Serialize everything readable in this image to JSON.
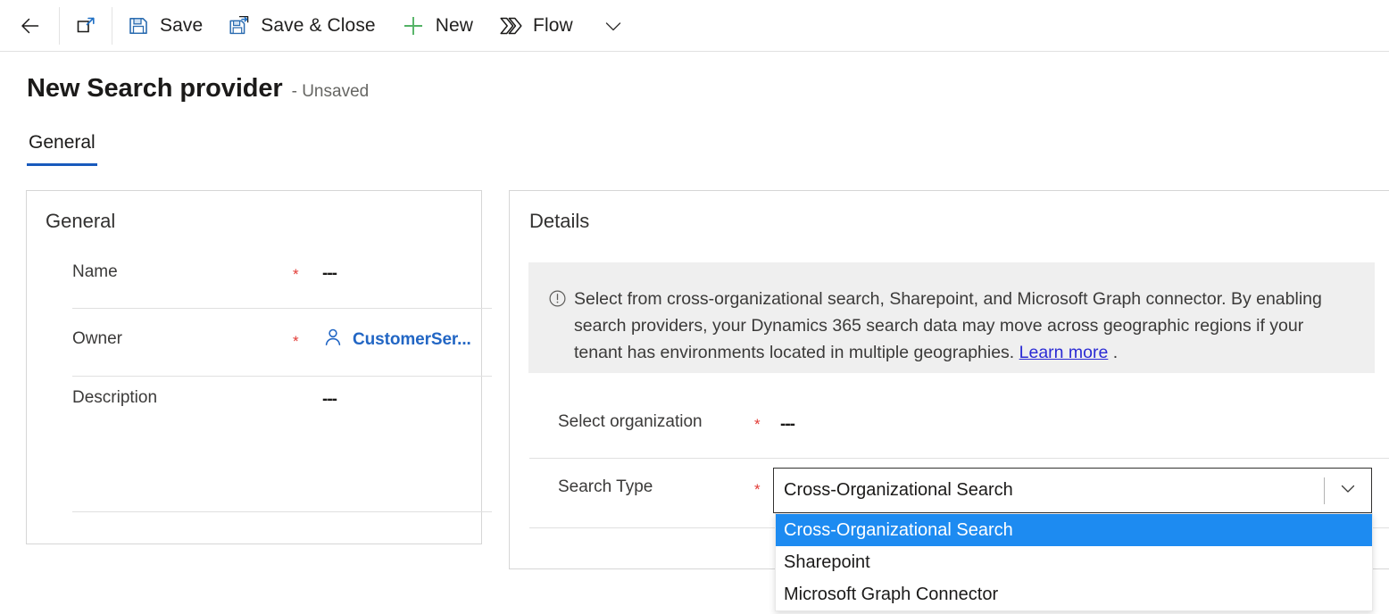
{
  "commandbar": {
    "items": [
      {
        "icon": "back-arrow-icon",
        "label": ""
      },
      {
        "icon": "popout-icon",
        "label": ""
      },
      {
        "icon": "save-icon",
        "label": "Save"
      },
      {
        "icon": "save-and-close-icon",
        "label": "Save & Close"
      },
      {
        "icon": "plus-icon",
        "label": "New"
      },
      {
        "icon": "flow-icon",
        "label": "Flow"
      },
      {
        "icon": "chevron-down-icon",
        "label": ""
      }
    ],
    "back_label": "Back",
    "popout_label": "Open in new window",
    "save_label": "Save",
    "save_close_label": "Save & Close",
    "new_label": "New",
    "flow_label": "Flow"
  },
  "header": {
    "title": "New Search provider",
    "status": "- Unsaved"
  },
  "tabs": [
    {
      "label": "General",
      "active": true
    }
  ],
  "general_card": {
    "title": "General",
    "rows": [
      {
        "label": "Name",
        "required": "*",
        "value": "---"
      },
      {
        "label": "Owner",
        "required": "*",
        "value": "CustomerSer...",
        "icon": "person-icon"
      },
      {
        "label": "Description",
        "required": "",
        "value": "---"
      }
    ]
  },
  "details_card": {
    "title": "Details",
    "infobar": {
      "icon": "info-circle-icon",
      "text_before": "Select from cross-organizational search, Sharepoint, and Microsoft Graph connector. By enabling search providers, your Dynamics 365 search data may move across geographic regions if your tenant has environments located in multiple geographies. ",
      "link": "Learn more",
      "text_after": " ."
    },
    "rows": [
      {
        "label": "Select organization",
        "required": "*",
        "value": "---"
      },
      {
        "label": "Search Type",
        "required": "*",
        "value": "Cross-Organizational Search"
      }
    ],
    "search_type_combo": {
      "value": "Cross-Organizational Search",
      "caret_icon": "chevron-down-icon",
      "options": [
        {
          "label": "Cross-Organizational Search",
          "selected": true
        },
        {
          "label": "Sharepoint",
          "selected": false
        },
        {
          "label": "Microsoft Graph Connector",
          "selected": false
        }
      ]
    }
  },
  "colors": {
    "accent_blue": "#185abd",
    "link_blue": "#2b2bd4",
    "owner_blue": "#2266c4",
    "required_red": "#e23b36",
    "new_green": "#53b265",
    "highlight_blue": "#1d8bf1",
    "infobar_bg": "#efefef"
  }
}
